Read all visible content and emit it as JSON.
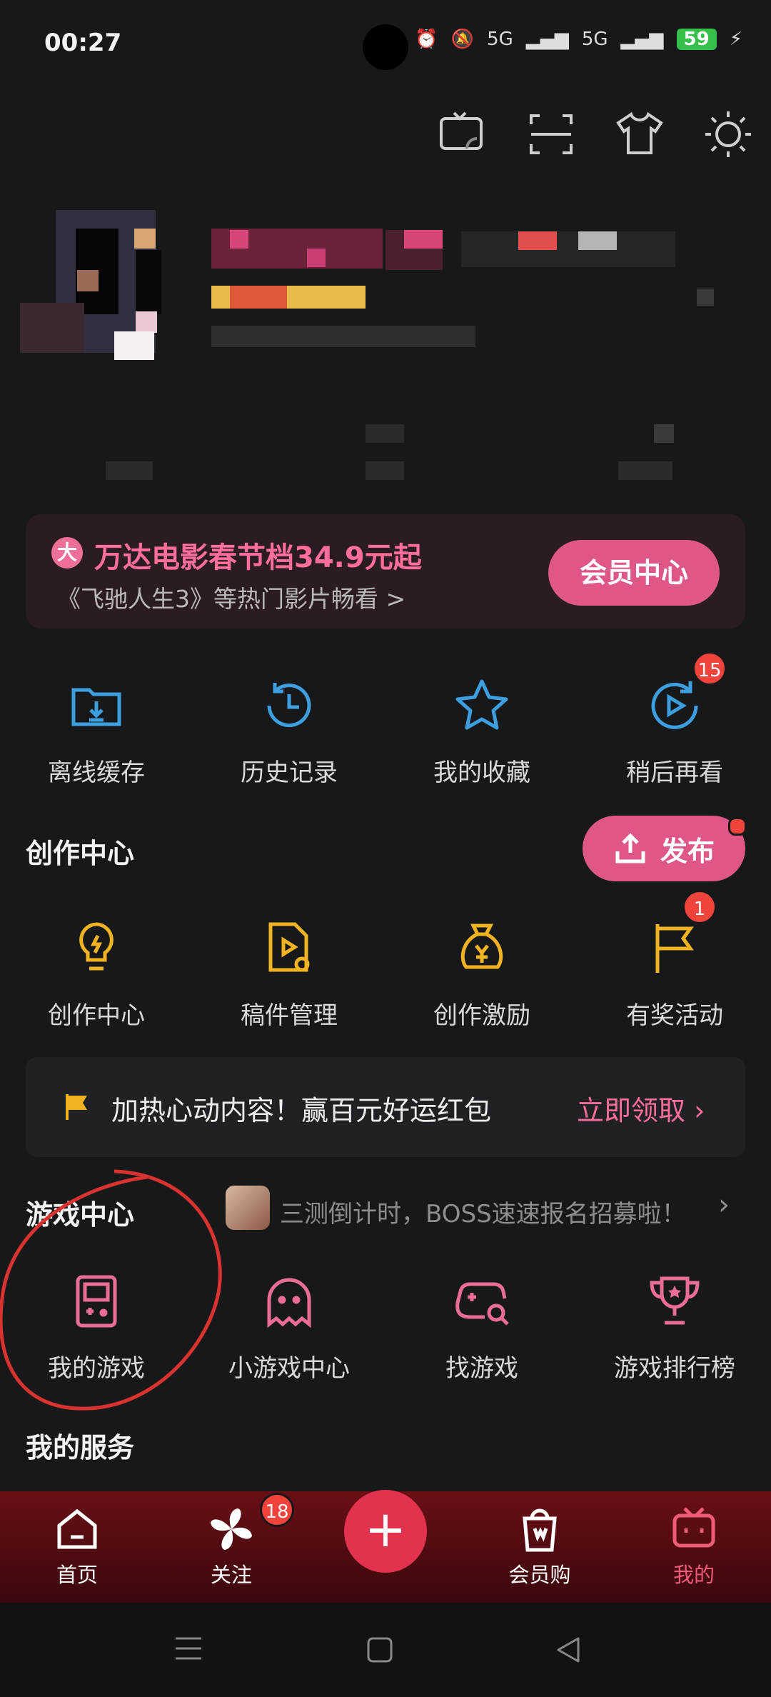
{
  "status_bar": {
    "time": "00:27",
    "battery": "59",
    "network_1": "5G",
    "network_2": "5G"
  },
  "top_tools": [
    {
      "name": "cast-tv-icon"
    },
    {
      "name": "scan-icon"
    },
    {
      "name": "theme-shirt-icon"
    },
    {
      "name": "brightness-icon"
    }
  ],
  "banner": {
    "badge": "大",
    "title": "万达电影春节档34.9元起",
    "subtitle": "《飞驰人生3》等热门影片畅看 >",
    "button": "会员中心"
  },
  "quick_actions": [
    {
      "label": "离线缓存",
      "icon": "download-folder-icon"
    },
    {
      "label": "历史记录",
      "icon": "history-clock-icon"
    },
    {
      "label": "我的收藏",
      "icon": "star-icon"
    },
    {
      "label": "稍后再看",
      "icon": "watch-later-icon",
      "badge": "15"
    }
  ],
  "creation": {
    "title": "创作中心",
    "publish_button": "发布",
    "items": [
      {
        "label": "创作中心",
        "icon": "lightbulb-icon"
      },
      {
        "label": "稿件管理",
        "icon": "manuscript-icon"
      },
      {
        "label": "创作激励",
        "icon": "money-bag-icon"
      },
      {
        "label": "有奖活动",
        "icon": "flag-icon",
        "badge": "1"
      }
    ]
  },
  "promo": {
    "text": "加热心动内容！赢百元好运红包",
    "link": "立即领取"
  },
  "games": {
    "title": "游戏中心",
    "tip": "三测倒计时，BOSS速速报名招募啦！",
    "items": [
      {
        "label": "我的游戏",
        "icon": "handheld-console-icon"
      },
      {
        "label": "小游戏中心",
        "icon": "ghost-icon"
      },
      {
        "label": "找游戏",
        "icon": "gamepad-search-icon"
      },
      {
        "label": "游戏排行榜",
        "icon": "trophy-icon"
      }
    ]
  },
  "services": {
    "title": "我的服务"
  },
  "bottom_nav": {
    "home": "首页",
    "follow": "关注",
    "follow_badge": "18",
    "plus": "+",
    "shop": "会员购",
    "mine": "我的"
  },
  "colors": {
    "accent": "#de5788",
    "pink_text": "#ff6e9a",
    "blue_icon": "#3d9fe0",
    "yellow_icon": "#f2b322",
    "badge_red": "#f0433c"
  }
}
